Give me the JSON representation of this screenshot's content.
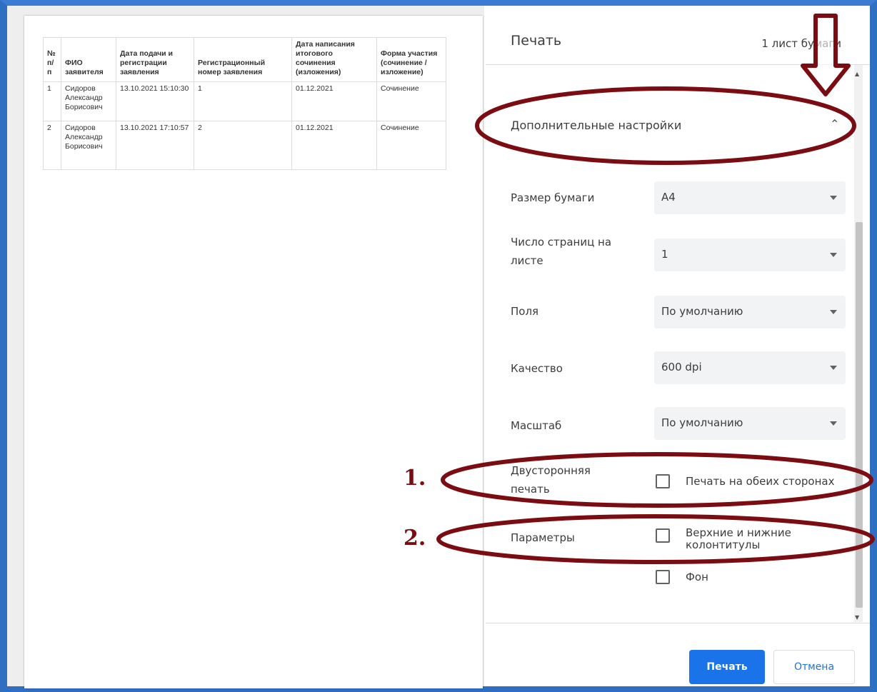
{
  "preview": {
    "table": {
      "headers": [
        "№ п/ п",
        "ФИО заявителя",
        "Дата подачи и регистрации заявления",
        "Регистрационный номер заявления",
        "Дата написания итогового сочинения (изложения)",
        "Форма участия (сочинение / изложение)"
      ],
      "rows": [
        [
          "1",
          "Сидоров Александр Борисович",
          "13.10.2021 15:10:30",
          "1",
          "01.12.2021",
          "Сочинение"
        ],
        [
          "2",
          "Сидоров Александр Борисович",
          "13.10.2021 17:10:57",
          "2",
          "01.12.2021",
          "Сочинение"
        ]
      ]
    }
  },
  "panel": {
    "title": "Печать",
    "sheets": "1 лист бумаги",
    "advanced": "Дополнительные настройки",
    "settings": [
      {
        "label": "Размер бумаги",
        "value": "А4"
      },
      {
        "label": "Число страниц на листе",
        "value": "1"
      },
      {
        "label": "Поля",
        "value": "По умолчанию"
      },
      {
        "label": "Качество",
        "value": "600 dpi"
      },
      {
        "label": "Масштаб",
        "value": "По умолчанию"
      }
    ],
    "duplex": {
      "label": "Двусторонняя печать",
      "option": "Печать на обеих сторонах"
    },
    "options": {
      "label": "Параметры",
      "headers_footers": "Верхние и нижние колонтитулы",
      "background": "Фон"
    },
    "print_button": "Печать",
    "cancel_button": "Отмена"
  },
  "annotations": {
    "marker1": "1.",
    "marker2": "2."
  },
  "colors": {
    "accent": "#1a73e8",
    "annotation": "#7a0c12",
    "frame": "#2f6fc2"
  }
}
